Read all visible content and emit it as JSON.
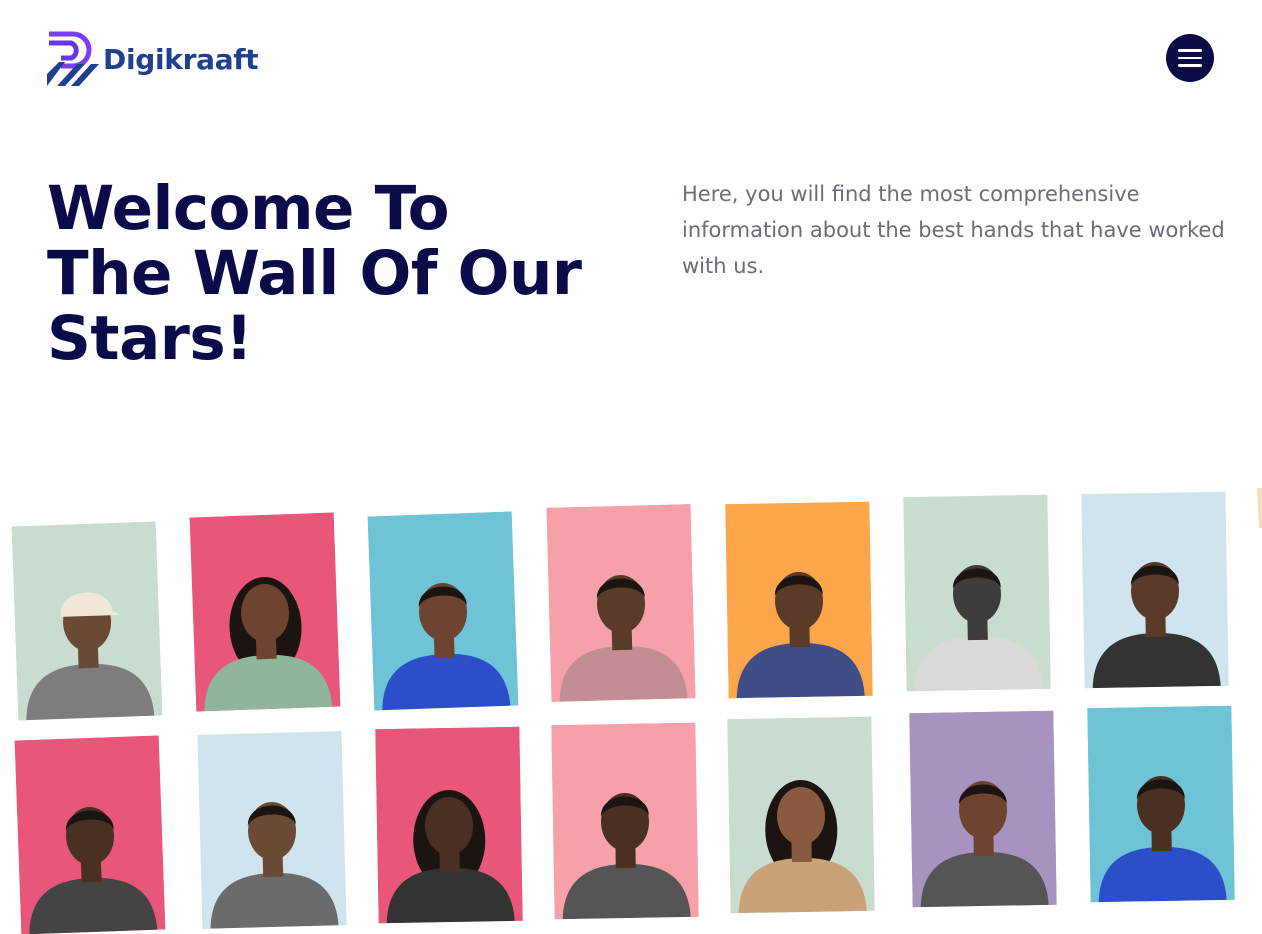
{
  "header": {
    "brand_name": "Digikraaft",
    "logo_icon": "digikraaft-logo-icon",
    "menu_icon": "hamburger-menu-icon",
    "colors": {
      "brand_purple": "#7b3ff2",
      "brand_navy": "#1f3f8f",
      "menu_bg": "#0b0b45"
    }
  },
  "hero": {
    "title_lines": [
      "Welcome To",
      "The Wall Of Our",
      "Stars!"
    ],
    "subtitle": "Here, you will find the most comprehensive information about the best hands that have worked with us."
  },
  "stars_wall": {
    "rows": [
      [
        {
          "bg": "#c8dcd0",
          "skin": "#6b4a35",
          "shirt": "#7d7d80",
          "hair": "cap"
        },
        {
          "bg": "#e8577a",
          "skin": "#6e4330",
          "shirt": "#8fb59a",
          "hair": "long"
        },
        {
          "bg": "#6ec3d6",
          "skin": "#6e4330",
          "shirt": "#2a4fc9",
          "hair": "short"
        },
        {
          "bg": "#f6a0aa",
          "skin": "#5a3a28",
          "shirt": "#c38e93",
          "hair": "short"
        },
        {
          "bg": "#fba64b",
          "skin": "#5a3a28",
          "shirt": "#3f4e86",
          "hair": "short"
        },
        {
          "bg": "#c8dcd0",
          "skin": "#3d3d3d",
          "shirt": "#d9d9d9",
          "hair": "short"
        },
        {
          "bg": "#cfe4ef",
          "skin": "#5a3a28",
          "shirt": "#333333",
          "hair": "short"
        }
      ],
      [
        {
          "bg": "#e8577a",
          "skin": "#4a3022",
          "shirt": "#444444",
          "hair": "short"
        },
        {
          "bg": "#cfe4ef",
          "skin": "#6b4a35",
          "shirt": "#6b6b6b",
          "hair": "short"
        },
        {
          "bg": "#e8577a",
          "skin": "#4a3022",
          "shirt": "#333333",
          "hair": "long"
        },
        {
          "bg": "#f6a0aa",
          "skin": "#4a3022",
          "shirt": "#555555",
          "hair": "short"
        },
        {
          "bg": "#c8dcd0",
          "skin": "#8a5a40",
          "shirt": "#c9a27a",
          "hair": "long"
        },
        {
          "bg": "#a793c0",
          "skin": "#6e4330",
          "shirt": "#555555",
          "hair": "short"
        },
        {
          "bg": "#6ec3d6",
          "skin": "#4a3022",
          "shirt": "#2a4fc9",
          "hair": "short"
        }
      ]
    ]
  }
}
